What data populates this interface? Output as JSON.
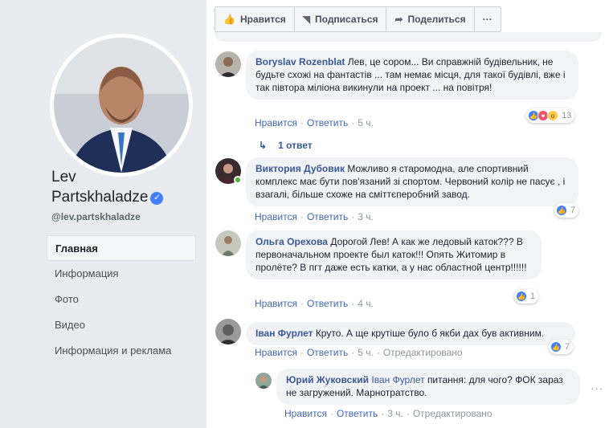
{
  "profile": {
    "name_line1": "Lev",
    "name_line2": "Partskhaladze",
    "handle": "@lev.partskhaladze"
  },
  "nav": [
    {
      "label": "Главная",
      "active": true
    },
    {
      "label": "Информация"
    },
    {
      "label": "Фото"
    },
    {
      "label": "Видео"
    },
    {
      "label": "Информация и реклама"
    }
  ],
  "actions": {
    "like": "Нравится",
    "follow": "Подписаться",
    "share": "Поделиться",
    "more": "···"
  },
  "comments": [
    {
      "author": "Boryslav Rozenblat",
      "text": "Лев, це сором... Ви справжній будівельник, не будьте схожі на фантастів ... там немає місця, для такої будівлі, вже і так півтора міліона викинули на проект ... на повітря!",
      "like": "Нравится",
      "reply": "Ответить",
      "time": "5 ч.",
      "reactions": "13"
    },
    {
      "author": "Виктория Дубовик",
      "text": "Можливо я старомодна, але спортивний комплекс має бути пов'язаний зі спортом. Червоний колір не пасує , і взагалі, більше схоже на сміттєперобний завод.",
      "like": "Нравится",
      "reply": "Ответить",
      "time": "3 ч.",
      "reactions": "7"
    },
    {
      "author": "Ольга Орехова",
      "text": "Дорогой Лев! А как же ледовый каток??? В первоначальном проекте был каток!!! Опять Житомир в пролёте? В пгт даже есть катки, а у нас областной центр!!!!!!",
      "like": "Нравится",
      "reply": "Ответить",
      "time": "4 ч.",
      "reactions": "1"
    },
    {
      "author": "Іван Фурлет",
      "text": "Круто. А ще крутіше було б якби дах був активним.",
      "like": "Нравится",
      "reply": "Ответить",
      "time": "5 ч.",
      "edited": "Отредактировано",
      "reactions": "7"
    }
  ],
  "replies_link": "1 ответ",
  "reply": {
    "author": "Юрий Жуковский",
    "mention": "Іван Фурлет",
    "text": "питання: для чого? ФОК зараз не загружений. Марнотратство.",
    "like": "Нравится",
    "reply": "Ответить",
    "time": "3 ч.",
    "edited": "Отредактировано"
  },
  "colors": {
    "link": "#385898",
    "accent": "#4267b2",
    "bubble": "#f2f3f5"
  }
}
